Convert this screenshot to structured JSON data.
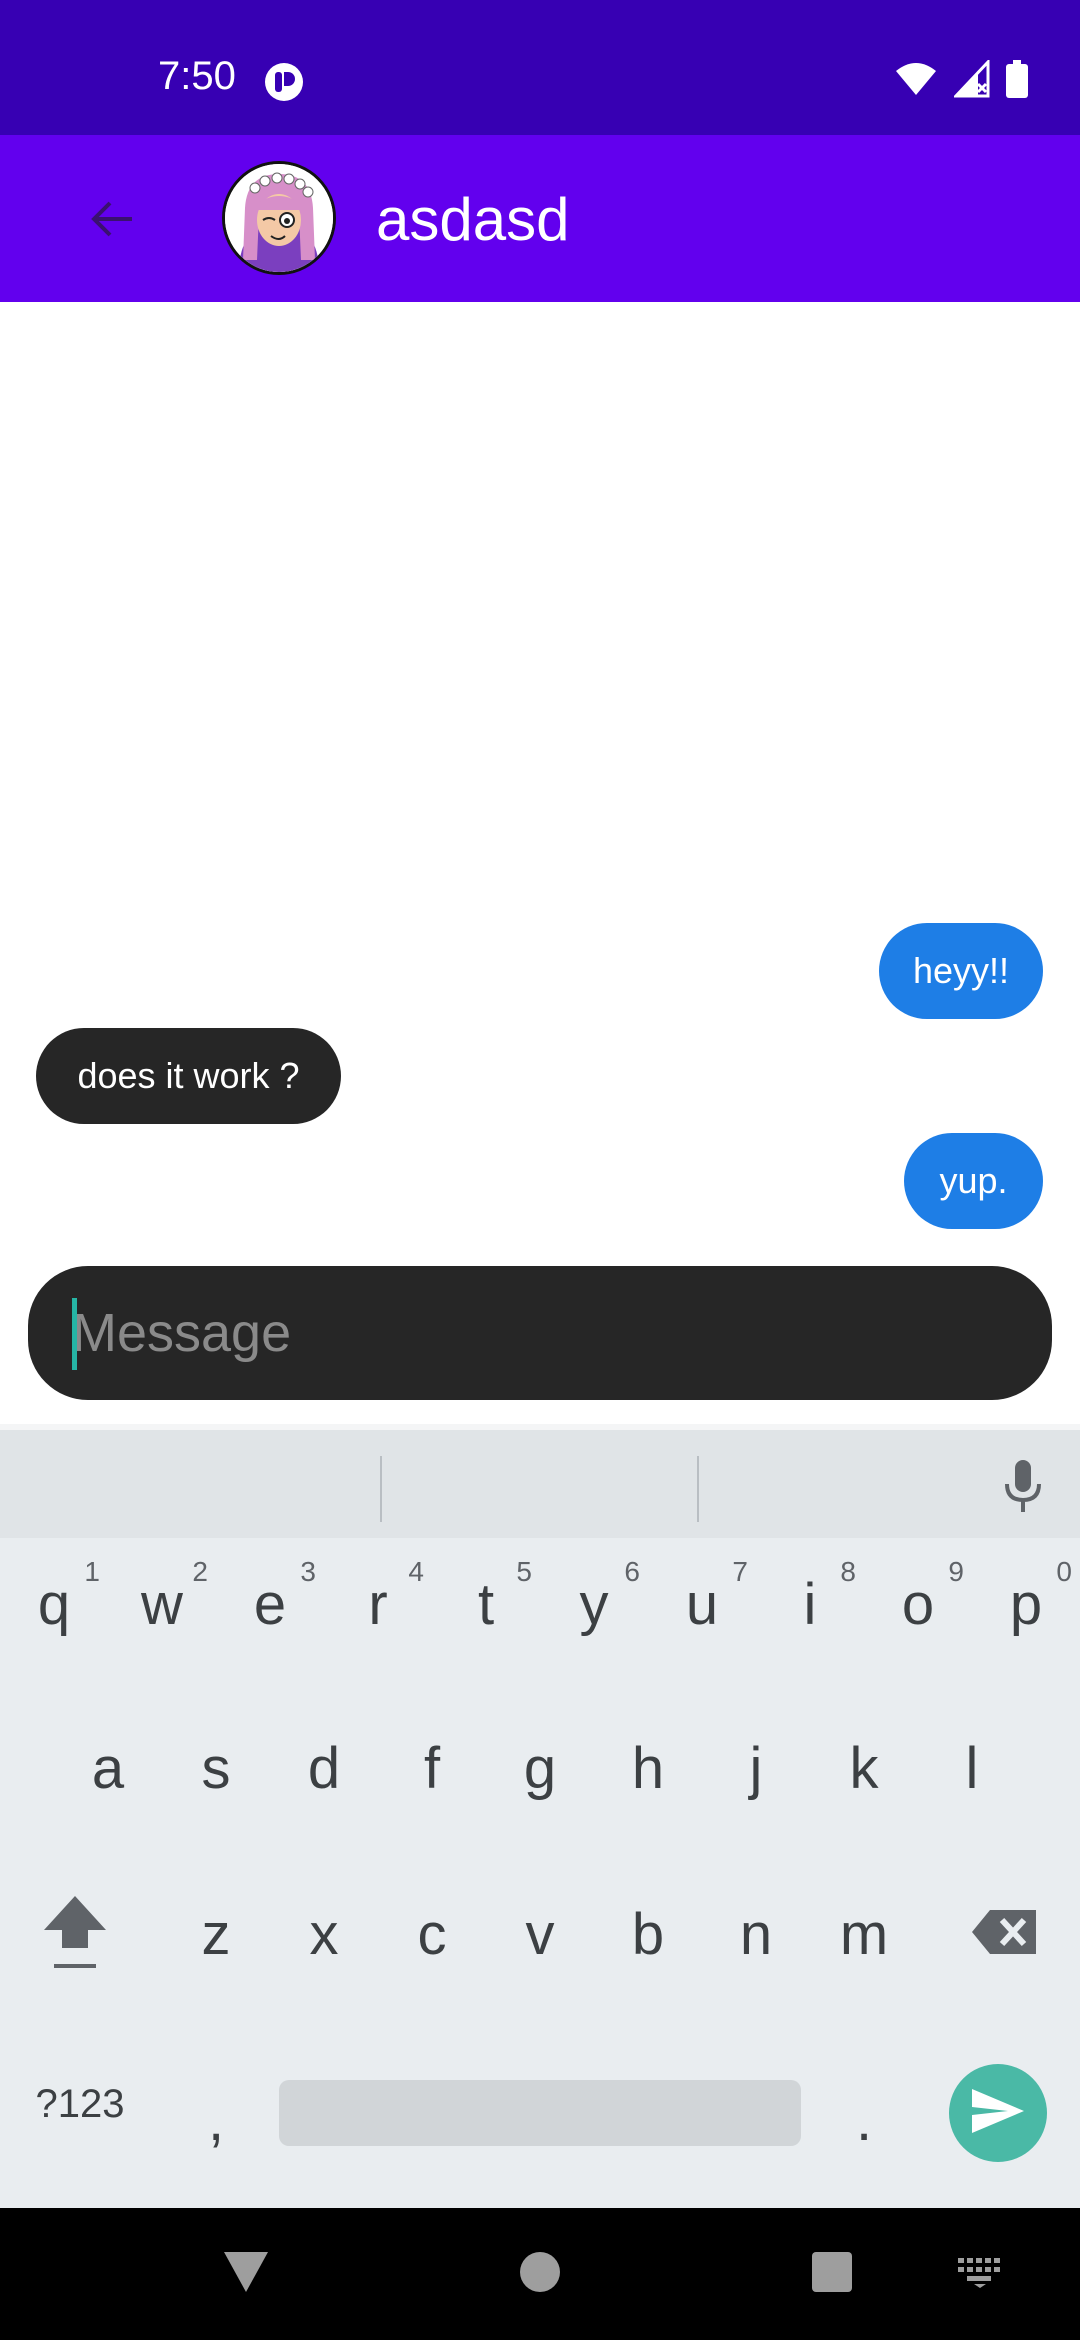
{
  "status_bar": {
    "time": "7:50",
    "icons": [
      "app-notification-icon",
      "wifi-icon",
      "cellular-no-signal-icon",
      "battery-icon"
    ]
  },
  "app_bar": {
    "back_icon": "arrow-left-icon",
    "avatar": "contact-avatar",
    "title": "asdasd"
  },
  "messages": [
    {
      "direction": "sent",
      "text": "heyy!!"
    },
    {
      "direction": "received",
      "text": "does it work ?"
    },
    {
      "direction": "sent",
      "text": "yup."
    }
  ],
  "composer": {
    "placeholder": "Message",
    "value": ""
  },
  "keyboard": {
    "row1": [
      {
        "key": "q",
        "hint": "1"
      },
      {
        "key": "w",
        "hint": "2"
      },
      {
        "key": "e",
        "hint": "3"
      },
      {
        "key": "r",
        "hint": "4"
      },
      {
        "key": "t",
        "hint": "5"
      },
      {
        "key": "y",
        "hint": "6"
      },
      {
        "key": "u",
        "hint": "7"
      },
      {
        "key": "i",
        "hint": "8"
      },
      {
        "key": "o",
        "hint": "9"
      },
      {
        "key": "p",
        "hint": "0"
      }
    ],
    "row2": [
      "a",
      "s",
      "d",
      "f",
      "g",
      "h",
      "j",
      "k",
      "l"
    ],
    "row3": [
      "z",
      "x",
      "c",
      "v",
      "b",
      "n",
      "m"
    ],
    "symbols_label": "?123",
    "comma": ",",
    "period": ".",
    "icons": [
      "mic-icon",
      "shift-icon",
      "backspace-icon",
      "send-icon"
    ]
  },
  "nav_bar": {
    "icons": [
      "back-triangle-icon",
      "home-circle-icon",
      "recents-square-icon",
      "keyboard-switch-icon"
    ]
  },
  "colors": {
    "status_bar": "#3700b3",
    "app_bar": "#6200ee",
    "sent_bubble": "#1e7ee6",
    "received_bubble": "#262626",
    "composer": "#262626",
    "cursor": "#26b5a5",
    "keyboard_bg": "#e9edf0",
    "enter_key": "#4ab9a6"
  }
}
